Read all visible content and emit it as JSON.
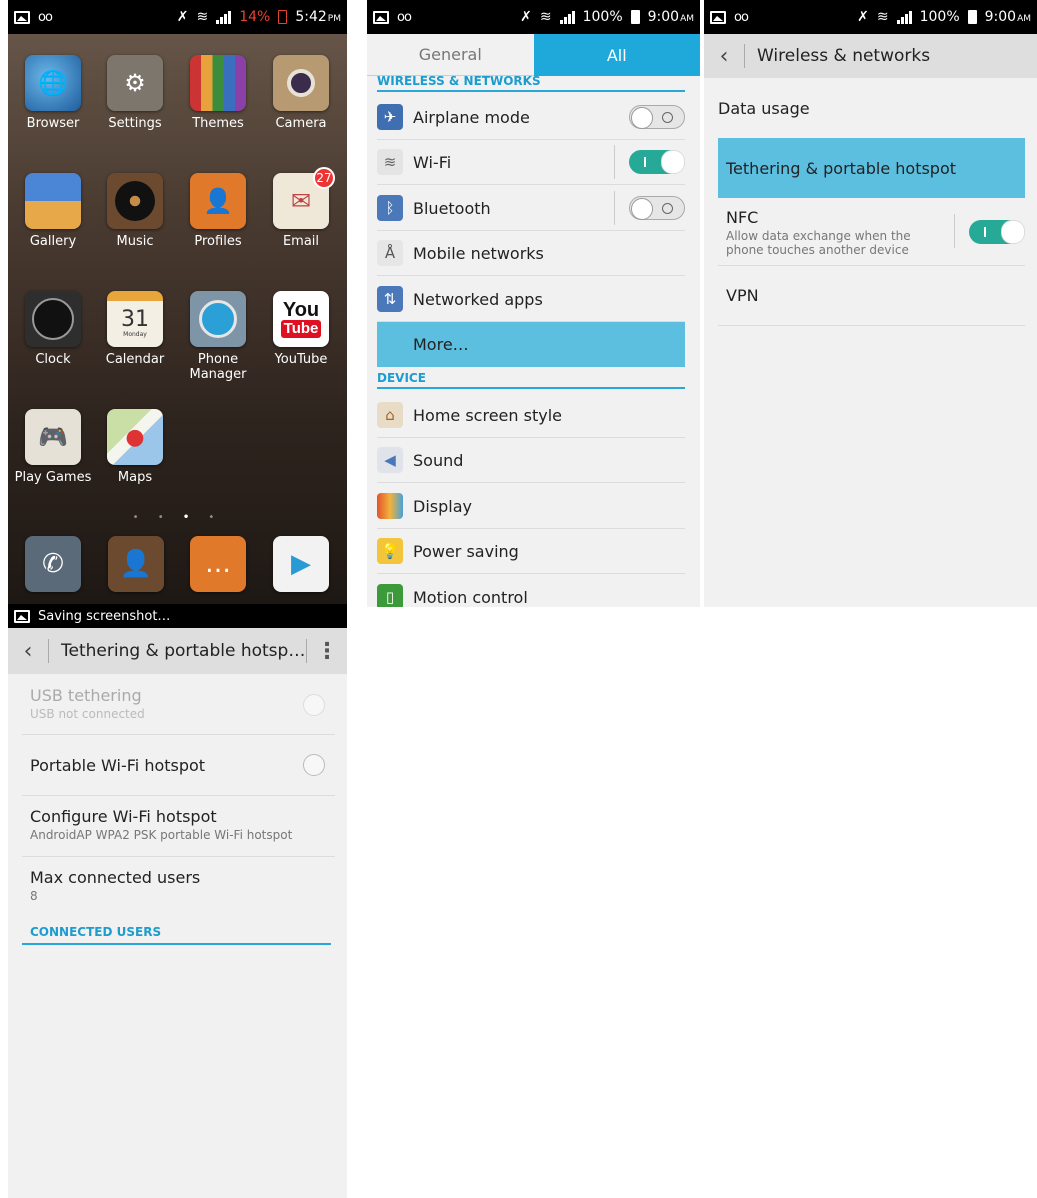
{
  "home": {
    "status": {
      "battery": "14%",
      "time": "5:42",
      "ampm": "PM"
    },
    "apps": [
      {
        "label": "Browser",
        "icon": "globe-icon",
        "color": "#3a7fc0"
      },
      {
        "label": "Settings",
        "icon": "gear-icon",
        "color": "#6f6a62"
      },
      {
        "label": "Themes",
        "icon": "pencils-icon",
        "color": "#8b5e3c"
      },
      {
        "label": "Camera",
        "icon": "camera-icon",
        "color": "#9a7b55"
      },
      {
        "label": "Gallery",
        "icon": "landscape-icon",
        "color": "#3f6fb0"
      },
      {
        "label": "Music",
        "icon": "vinyl-icon",
        "color": "#6b4a30"
      },
      {
        "label": "Profiles",
        "icon": "person-icon",
        "color": "#e07a2a"
      },
      {
        "label": "Email",
        "icon": "envelope-icon",
        "color": "#e9e1cf",
        "badge": "27"
      },
      {
        "label": "Clock",
        "icon": "clock-icon",
        "color": "#3b3b3b"
      },
      {
        "label": "Calendar",
        "icon": "calendar-icon",
        "color": "#e7a53a",
        "date": "31",
        "weekday": "Monday"
      },
      {
        "label": "Phone Manager",
        "icon": "gauge-icon",
        "color": "#6a8aa2"
      },
      {
        "label": "YouTube",
        "icon": "youtube-icon",
        "color": "#ffffff",
        "text1": "You",
        "text2": "Tube"
      },
      {
        "label": "Play Games",
        "icon": "gamepad-icon",
        "color": "#e6e1d6"
      },
      {
        "label": "Maps",
        "icon": "map-icon",
        "color": "#dfe7cf"
      }
    ],
    "dock": [
      {
        "icon": "phone-icon",
        "color": "#5a6a78"
      },
      {
        "icon": "contacts-icon",
        "color": "#6b4a30"
      },
      {
        "icon": "messages-icon",
        "color": "#e07a2a"
      },
      {
        "icon": "play-store-icon",
        "color": "#f2f2f2"
      }
    ]
  },
  "settings": {
    "status": {
      "battery": "100%",
      "time": "9:00",
      "ampm": "AM"
    },
    "tabs": {
      "general": "General",
      "all": "All"
    },
    "section_wireless": "WIRELESS & NETWORKS",
    "section_device": "DEVICE",
    "wireless_items": [
      {
        "label": "Airplane mode",
        "icon": "airplane-icon"
      },
      {
        "label": "Wi-Fi",
        "icon": "wifi-icon"
      },
      {
        "label": "Bluetooth",
        "icon": "bluetooth-icon"
      },
      {
        "label": "Mobile networks",
        "icon": "antenna-icon"
      },
      {
        "label": "Networked apps",
        "icon": "networked-apps-icon"
      },
      {
        "label": "More…"
      }
    ],
    "device_items": [
      {
        "label": "Home screen style",
        "icon": "home-icon"
      },
      {
        "label": "Sound",
        "icon": "speaker-icon"
      },
      {
        "label": "Display",
        "icon": "display-icon"
      },
      {
        "label": "Power saving",
        "icon": "bulb-icon"
      },
      {
        "label": "Motion control",
        "icon": "motion-icon"
      }
    ]
  },
  "wireless": {
    "status": {
      "battery": "100%",
      "time": "9:00",
      "ampm": "AM"
    },
    "title": "Wireless & networks",
    "data_usage": "Data usage",
    "tethering": "Tethering & portable hotspot",
    "nfc_title": "NFC",
    "nfc_sub": "Allow data exchange when the phone touches another device",
    "vpn": "VPN"
  },
  "tethering": {
    "status_text": "Saving screenshot…",
    "title": "Tethering & portable hotsp…",
    "usb_title": "USB tethering",
    "usb_sub": "USB not connected",
    "portable": "Portable Wi-Fi hotspot",
    "configure_title": "Configure Wi-Fi hotspot",
    "configure_sub": "AndroidAP WPA2 PSK portable Wi-Fi hotspot",
    "max_title": "Max connected users",
    "max_value": "8",
    "connected_users": "CONNECTED USERS"
  }
}
